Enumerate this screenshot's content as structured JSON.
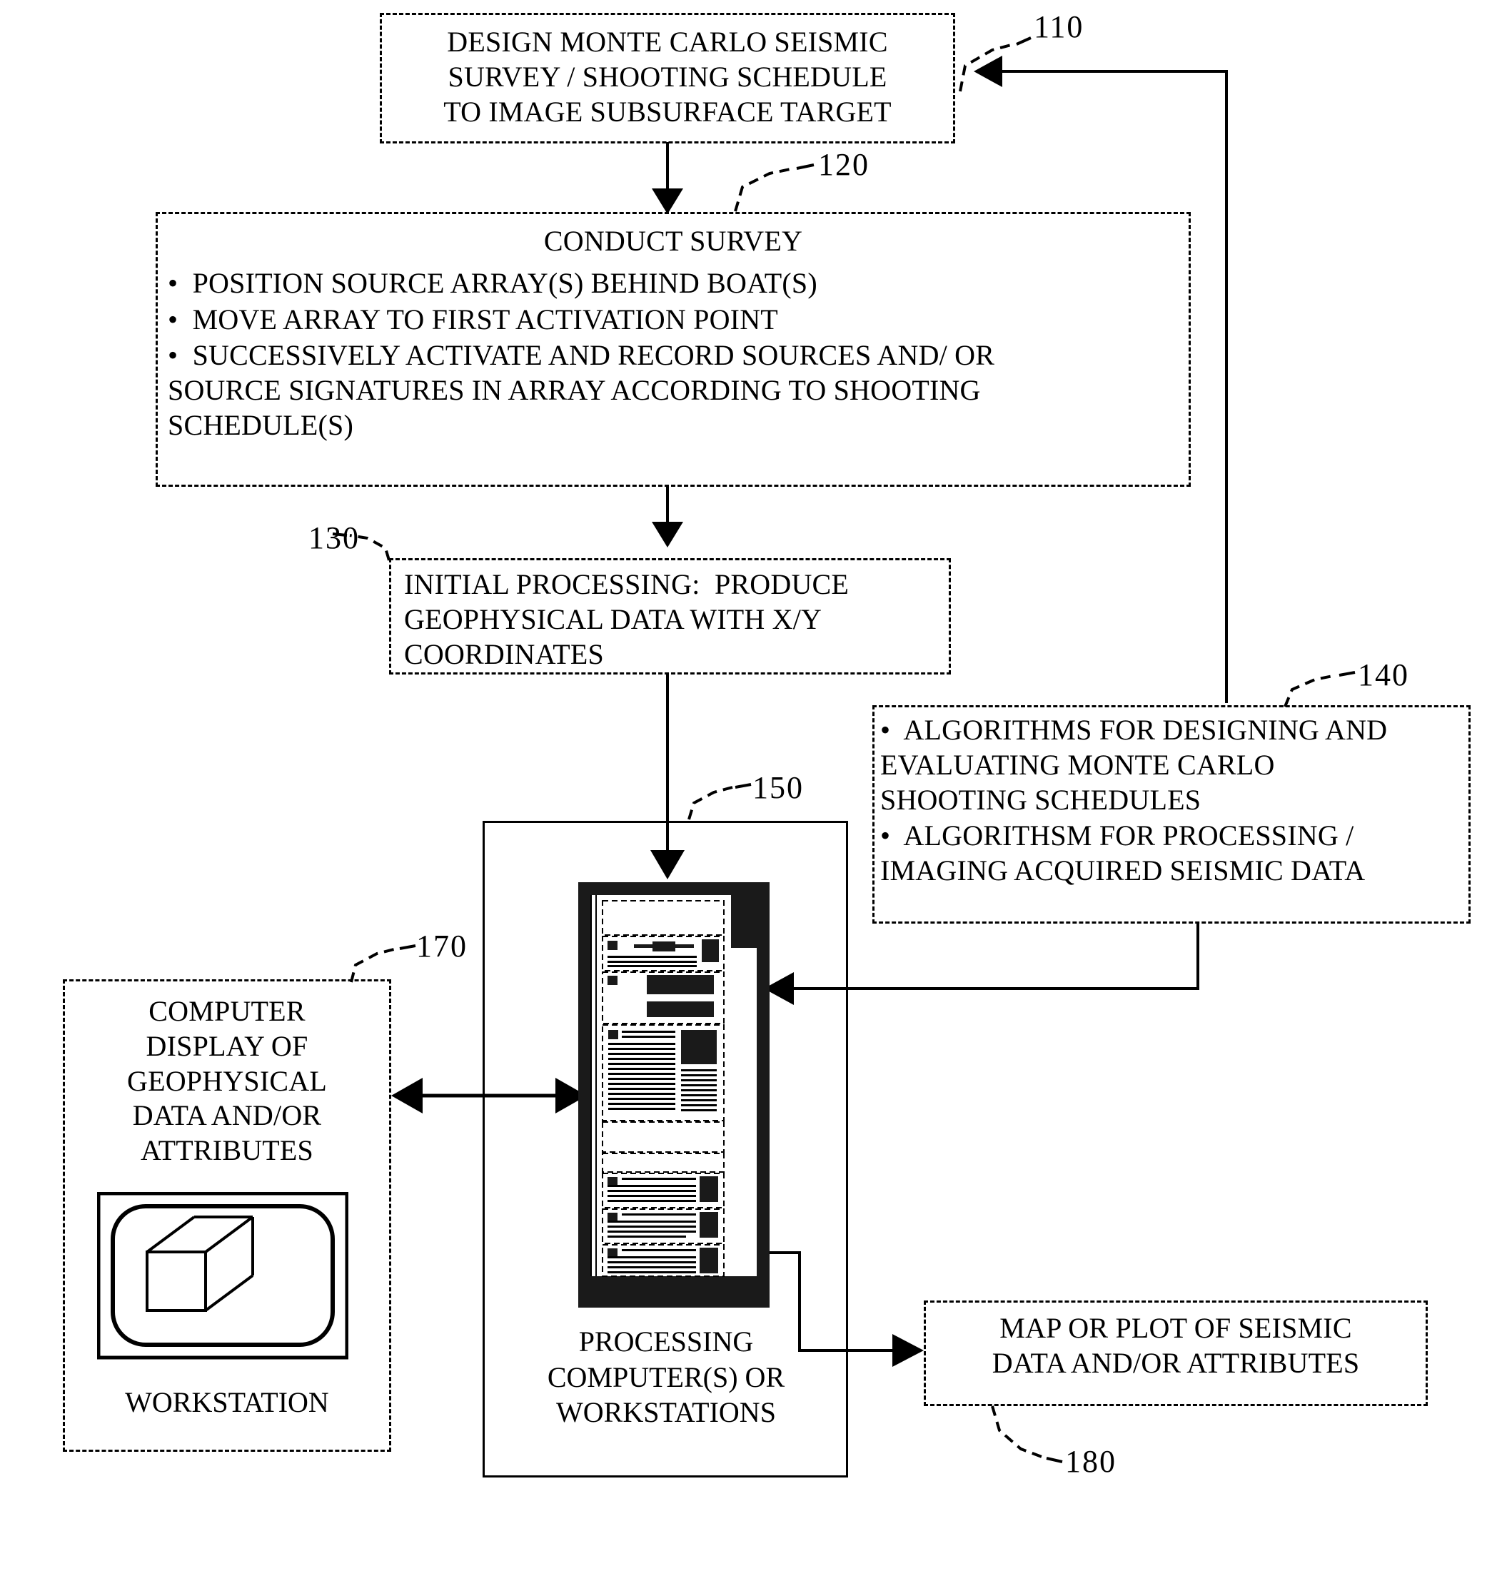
{
  "figure": {
    "type": "flowchart",
    "title": "Monte Carlo seismic survey workflow"
  },
  "boxes": {
    "design": {
      "ref": "110",
      "lines": [
        "DESIGN MONTE CARLO SEISMIC",
        "SURVEY / SHOOTING SCHEDULE",
        "TO IMAGE SUBSURFACE TARGET"
      ],
      "text": "DESIGN MONTE CARLO SEISMIC\nSURVEY / SHOOTING SCHEDULE\nTO IMAGE SUBSURFACE TARGET"
    },
    "conduct": {
      "ref": "120",
      "heading": "CONDUCT SURVEY",
      "bullet1": "•  POSITION SOURCE ARRAY(S) BEHIND BOAT(S)",
      "bullet2": "•  MOVE ARRAY TO FIRST ACTIVATION POINT",
      "bullet3": "•  SUCCESSIVELY ACTIVATE AND RECORD SOURCES AND/ OR\nSOURCE SIGNATURES IN ARRAY ACCORDING TO SHOOTING\nSCHEDULE(S)"
    },
    "initial": {
      "ref": "130",
      "text": "INITIAL PROCESSING:  PRODUCE\nGEOPHYSICAL DATA WITH X/Y\nCOORDINATES"
    },
    "algorithms": {
      "ref": "140",
      "bullet1": "•  ALGORITHMS FOR DESIGNING AND\nEVALUATING MONTE CARLO\nSHOOTING SCHEDULES",
      "bullet2": "•  ALGORITHSM FOR PROCESSING /\nIMAGING ACQUIRED SEISMIC DATA"
    },
    "processing": {
      "ref": "150",
      "caption": "PROCESSING\nCOMPUTER(S) OR\nWORKSTATIONS"
    },
    "display": {
      "ref": "170",
      "text": "COMPUTER\nDISPLAY OF\nGEOPHYSICAL\nDATA AND/OR\nATTRIBUTES",
      "caption": "WORKSTATION",
      "graphic": "3d-cube-on-monitor"
    },
    "output": {
      "ref": "180",
      "text": "MAP OR PLOT OF SEISMIC\nDATA AND/OR ATTRIBUTES"
    }
  },
  "connectors": [
    {
      "name": "design-to-conduct",
      "from": "110",
      "to": "120",
      "style": "arrow-down"
    },
    {
      "name": "conduct-to-initial",
      "from": "120",
      "to": "130",
      "style": "arrow-down"
    },
    {
      "name": "initial-to-processing",
      "from": "130",
      "to": "150",
      "style": "arrow-down"
    },
    {
      "name": "algorithms-to-design",
      "from": "140",
      "to": "110",
      "style": "arrow-left-up"
    },
    {
      "name": "algorithms-to-processing",
      "from": "140",
      "to": "150",
      "style": "arrow-left"
    },
    {
      "name": "display-to-processing",
      "from": "170",
      "to": "150",
      "style": "double-arrow"
    },
    {
      "name": "processing-to-output",
      "from": "150",
      "to": "180",
      "style": "arrow-right-down"
    }
  ],
  "colors": {
    "line": "#000000",
    "background": "#ffffff"
  }
}
